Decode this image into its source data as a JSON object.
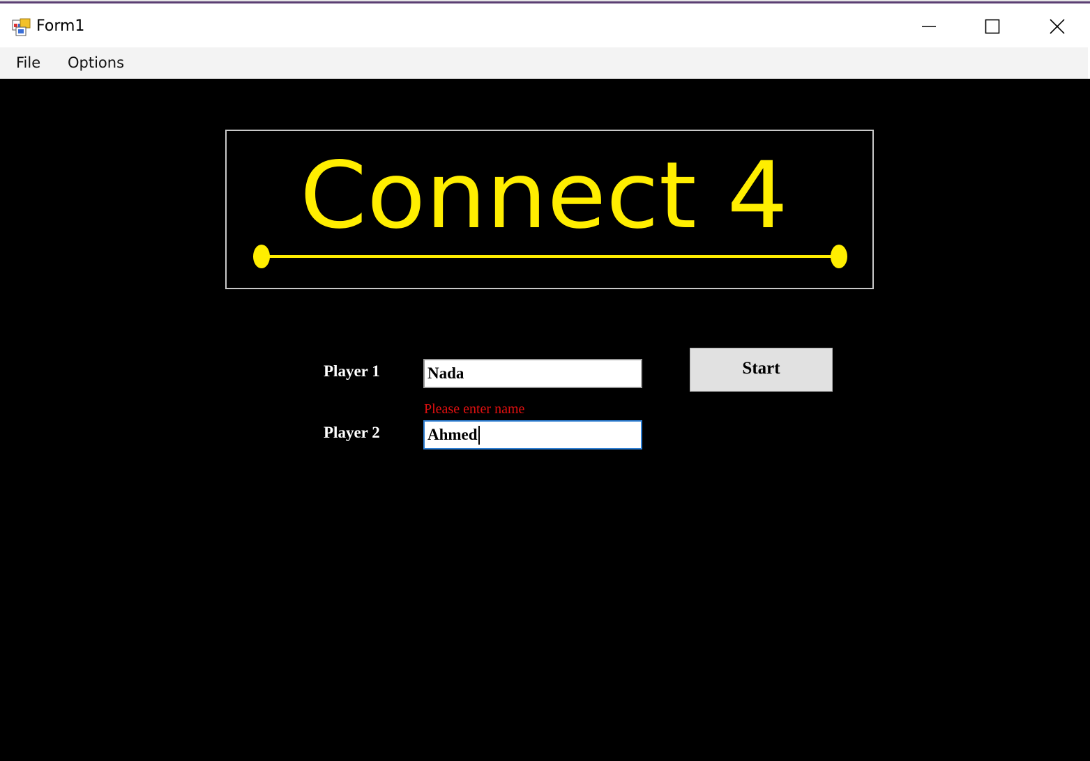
{
  "window": {
    "title": "Form1"
  },
  "menu": {
    "items": [
      {
        "label": "File"
      },
      {
        "label": "Options"
      }
    ]
  },
  "logo": {
    "text": "Connect 4",
    "color": "#ffee00"
  },
  "form": {
    "player1_label": "Player 1",
    "player1_value": "Nada",
    "player2_label": "Player 2",
    "player2_value": "Ahmed",
    "validation_message": "Please enter name",
    "start_label": "Start"
  },
  "colors": {
    "background": "#000000",
    "error": "#e01010",
    "focus_border": "#2f7fd3"
  }
}
